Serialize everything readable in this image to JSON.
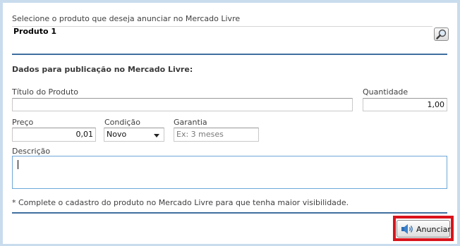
{
  "product": {
    "prompt_label": "Selecione o produto que deseja anunciar no Mercado Livre",
    "selected_value": "Produto 1"
  },
  "section": {
    "title": "Dados para publicação no Mercado Livre:"
  },
  "fields": {
    "titulo_label": "Título do Produto",
    "titulo_value": "",
    "quantidade_label": "Quantidade",
    "quantidade_value": "1,00",
    "preco_label": "Preço",
    "preco_value": "0,01",
    "condicao_label": "Condição",
    "condicao_value": "Novo",
    "garantia_label": "Garantia",
    "garantia_placeholder": "Ex: 3 meses",
    "descricao_label": "Descrição",
    "descricao_value": ""
  },
  "note": "* Complete o cadastro do produto no Mercado Livre para que tenha maior visibilidade.",
  "actions": {
    "anunciar_label": "Anunciar"
  },
  "icons": {
    "search": "magnifier-icon",
    "speaker": "speaker-icon"
  },
  "colors": {
    "accent_line": "#3f6f9e",
    "highlight": "#d9141c",
    "textarea_focus": "#6fa7d8"
  }
}
